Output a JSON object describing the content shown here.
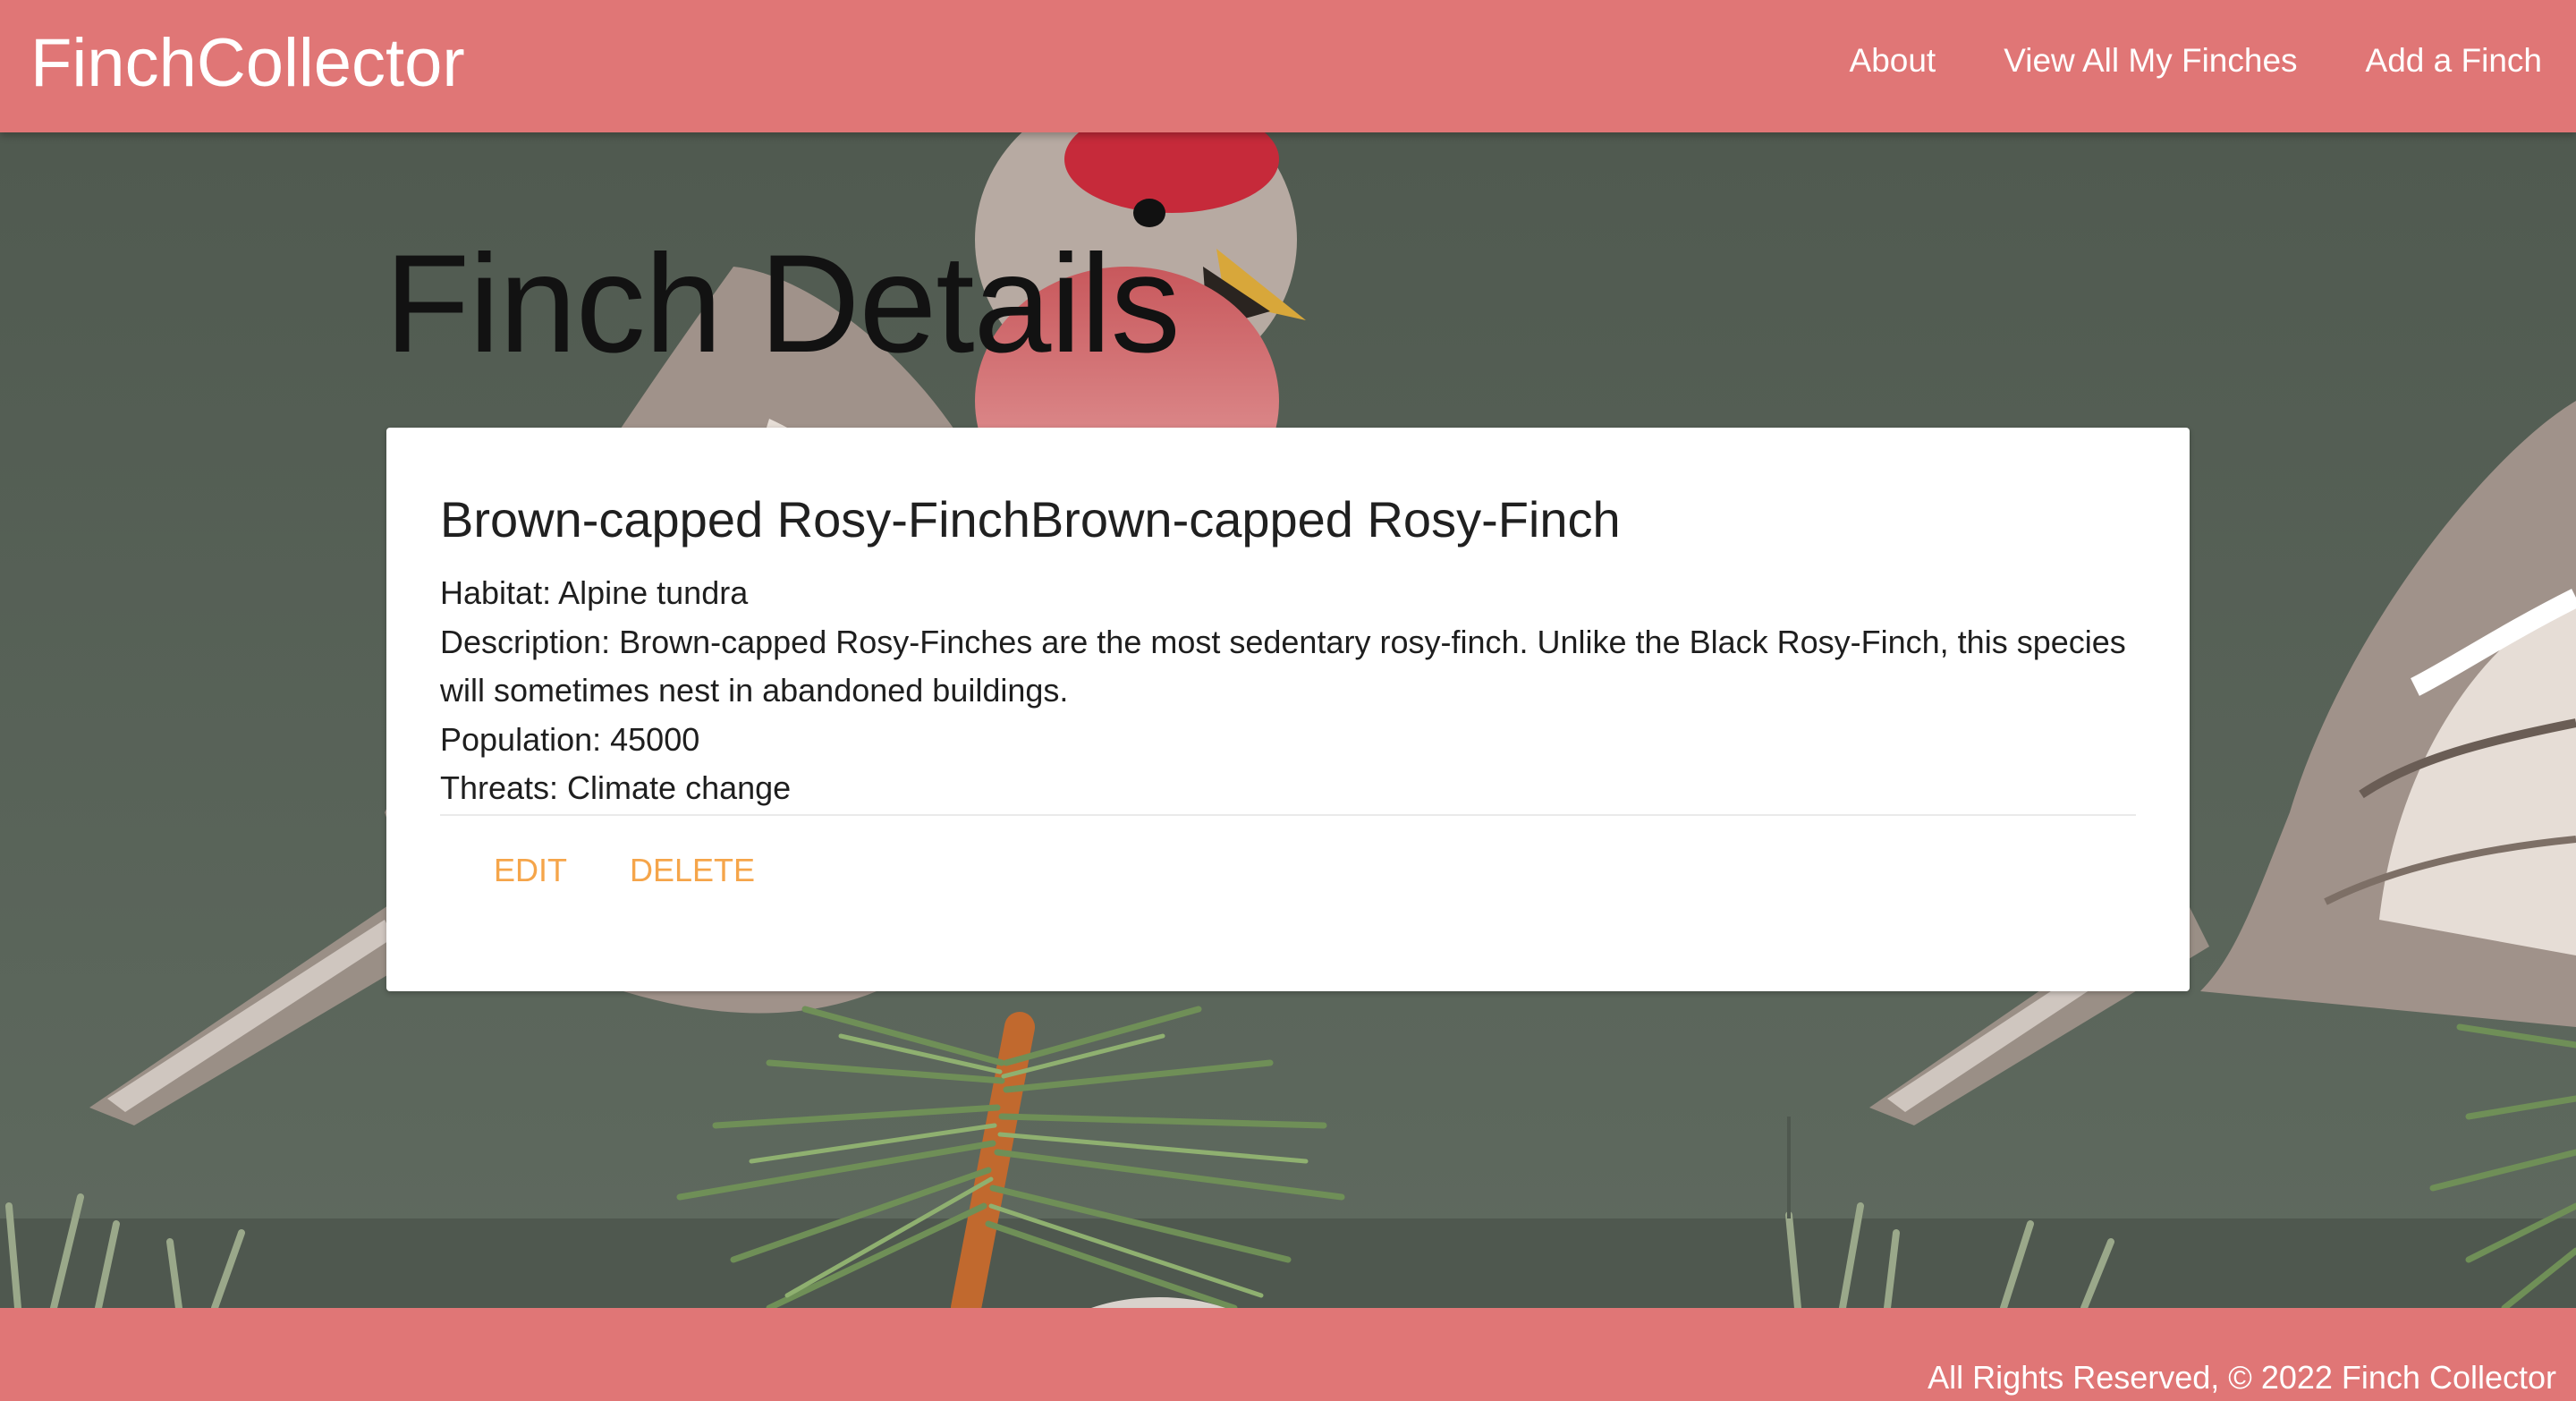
{
  "navbar": {
    "brand": "FinchCollector",
    "links": [
      "About",
      "View All My Finches",
      "Add a Finch"
    ]
  },
  "page": {
    "title": "Finch Details"
  },
  "finch": {
    "name": "Brown-capped Rosy-FinchBrown-capped Rosy-Finch",
    "habitat": "Habitat: Alpine tundra",
    "description": "Description: Brown-capped Rosy-Finches are the most sedentary rosy-finch. Unlike the Black Rosy-Finch, this species will sometimes nest in abandoned buildings.",
    "population": "Population: 45000",
    "threats": "Threats: Climate change"
  },
  "actions": {
    "edit": "Edit",
    "delete": "Delete"
  },
  "footer": {
    "copyright": "All Rights Reserved, © 2022 Finch Collector"
  },
  "colors": {
    "header_bg": "#e07676",
    "footer_bg": "#e07676",
    "action_link": "#f5a54a",
    "background": "#596359"
  }
}
